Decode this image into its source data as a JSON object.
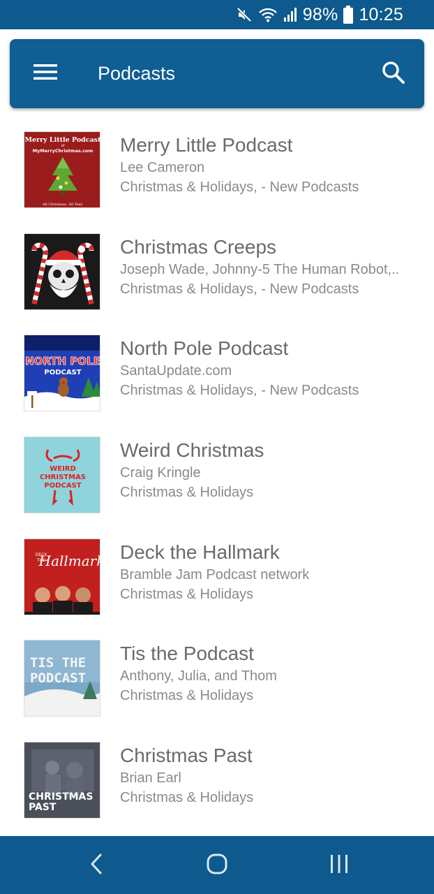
{
  "status_bar": {
    "battery": "98%",
    "time": "10:25",
    "icons": [
      "mute-icon",
      "wifi-icon",
      "signal-icon",
      "battery-icon"
    ]
  },
  "app_bar": {
    "title": "Podcasts",
    "menu_icon": "hamburger-menu-icon",
    "search_icon": "search-icon"
  },
  "podcasts": [
    {
      "title": "Merry Little Podcast",
      "author": "Lee Cameron",
      "category": "Christmas & Holidays, - New Podcasts",
      "art_text": [
        "Merry Little Podcast",
        "of",
        "MyMerryChristmas.com",
        "All Christmas. All Year."
      ]
    },
    {
      "title": "Christmas Creeps",
      "author": "Joseph Wade, Johnny-5 The Human Robot,..",
      "category": "Christmas & Holidays, - New Podcasts"
    },
    {
      "title": "North Pole Podcast",
      "author": "SantaUpdate.com",
      "category": "Christmas & Holidays, - New Podcasts",
      "art_text": [
        "NORTH POLE",
        "PODCAST"
      ]
    },
    {
      "title": "Weird Christmas",
      "author": "Craig Kringle",
      "category": "Christmas & Holidays",
      "art_text": [
        "WEIRD",
        "CHRISTMAS",
        "PODCAST"
      ]
    },
    {
      "title": "Deck the Hallmark",
      "author": "Bramble Jam Podcast network",
      "category": "Christmas & Holidays",
      "art_text": [
        "DECK",
        "THE",
        "Hallmark"
      ]
    },
    {
      "title": "Tis the Podcast",
      "author": "Anthony, Julia, and Thom",
      "category": "Christmas & Holidays",
      "art_text": [
        "TIS THE",
        "PODCAST"
      ]
    },
    {
      "title": "Christmas Past",
      "author": "Brian Earl",
      "category": "Christmas & Holidays",
      "art_text": [
        "CHRISTMAS",
        "PAST"
      ]
    }
  ],
  "nav_bar": {
    "back_icon": "back-icon",
    "home_icon": "home-icon",
    "recents_icon": "recents-icon"
  }
}
